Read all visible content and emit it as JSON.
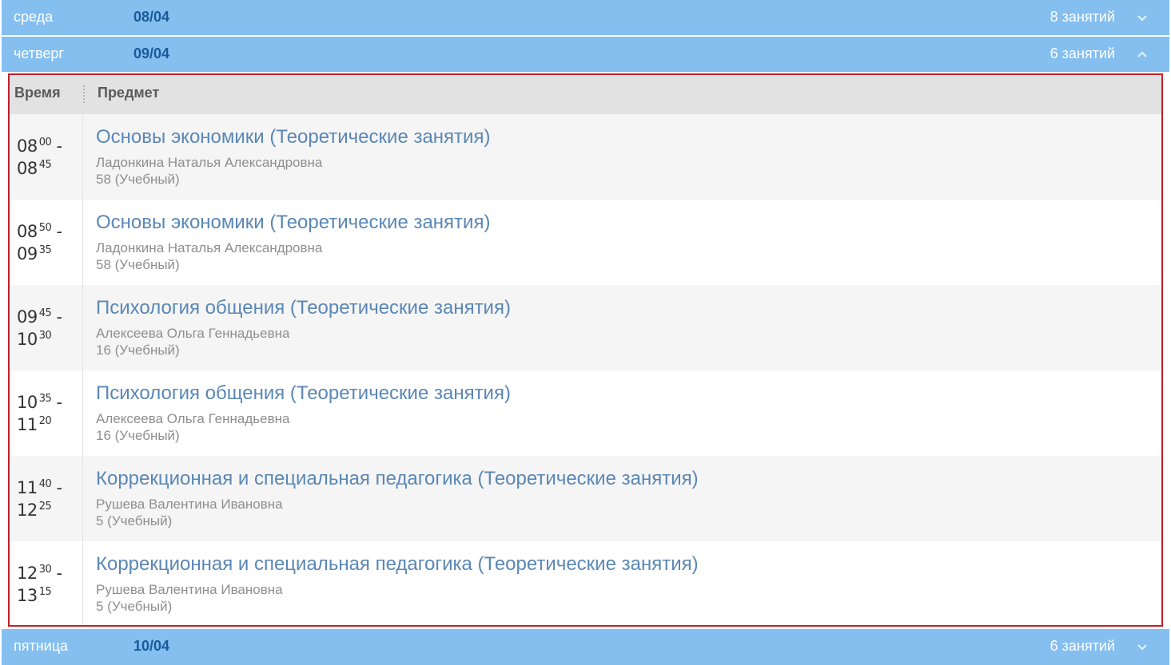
{
  "days": [
    {
      "name": "среда",
      "date": "08/04",
      "count": "8 занятий",
      "expanded": false
    },
    {
      "name": "четверг",
      "date": "09/04",
      "count": "6 занятий",
      "expanded": true
    },
    {
      "name": "пятница",
      "date": "10/04",
      "count": "6 занятий",
      "expanded": false
    }
  ],
  "table": {
    "header": {
      "time": "Время",
      "subject": "Предмет"
    },
    "rows": [
      {
        "start_h": "08",
        "start_m": "00",
        "end_h": "08",
        "end_m": "45",
        "subject": "Основы экономики (Теоретические занятия)",
        "teacher": "Ладонкина Наталья Александровна",
        "room": "58 (Учебный)"
      },
      {
        "start_h": "08",
        "start_m": "50",
        "end_h": "09",
        "end_m": "35",
        "subject": "Основы экономики (Теоретические занятия)",
        "teacher": "Ладонкина Наталья Александровна",
        "room": "58 (Учебный)"
      },
      {
        "start_h": "09",
        "start_m": "45",
        "end_h": "10",
        "end_m": "30",
        "subject": "Психология общения (Теоретические занятия)",
        "teacher": "Алексеева Ольга Геннадьевна",
        "room": "16 (Учебный)"
      },
      {
        "start_h": "10",
        "start_m": "35",
        "end_h": "11",
        "end_m": "20",
        "subject": "Психология общения (Теоретические занятия)",
        "teacher": "Алексеева Ольга Геннадьевна",
        "room": "16 (Учебный)"
      },
      {
        "start_h": "11",
        "start_m": "40",
        "end_h": "12",
        "end_m": "25",
        "subject": "Коррекционная и специальная педагогика (Теоретические занятия)",
        "teacher": "Рушева Валентина Ивановна",
        "room": "5 (Учебный)"
      },
      {
        "start_h": "12",
        "start_m": "30",
        "end_h": "13",
        "end_m": "15",
        "subject": "Коррекционная и специальная педагогика (Теоретические занятия)",
        "teacher": "Рушева Валентина Ивановна",
        "room": "5 (Учебный)"
      }
    ]
  },
  "icons": {
    "collapsed": "chevron-down-icon",
    "expanded": "chevron-up-icon"
  },
  "colors": {
    "day_bar": "#84bff0",
    "date_text": "#1a5a9a",
    "subject_link": "#5a87b5",
    "panel_border": "#c0202a"
  }
}
